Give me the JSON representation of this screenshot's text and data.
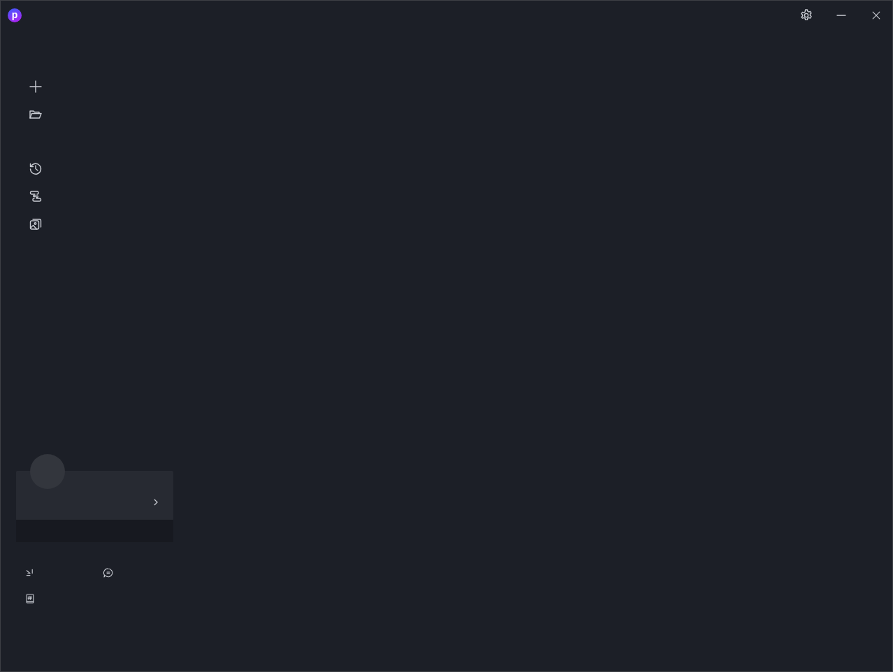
{
  "logo": {
    "text": "p"
  },
  "title_bar": {
    "buttons": [
      {
        "kind": "settings"
      },
      {
        "kind": "minimize"
      },
      {
        "kind": "close"
      }
    ]
  },
  "sidebar": {
    "items": [
      {
        "kind": "new"
      },
      {
        "kind": "open"
      },
      {
        "kind": "history"
      },
      {
        "kind": "connect"
      },
      {
        "kind": "gallery"
      }
    ]
  },
  "footer": {
    "items": [
      {
        "kind": "collapse"
      },
      {
        "kind": "feedback"
      },
      {
        "kind": "docs"
      }
    ]
  }
}
